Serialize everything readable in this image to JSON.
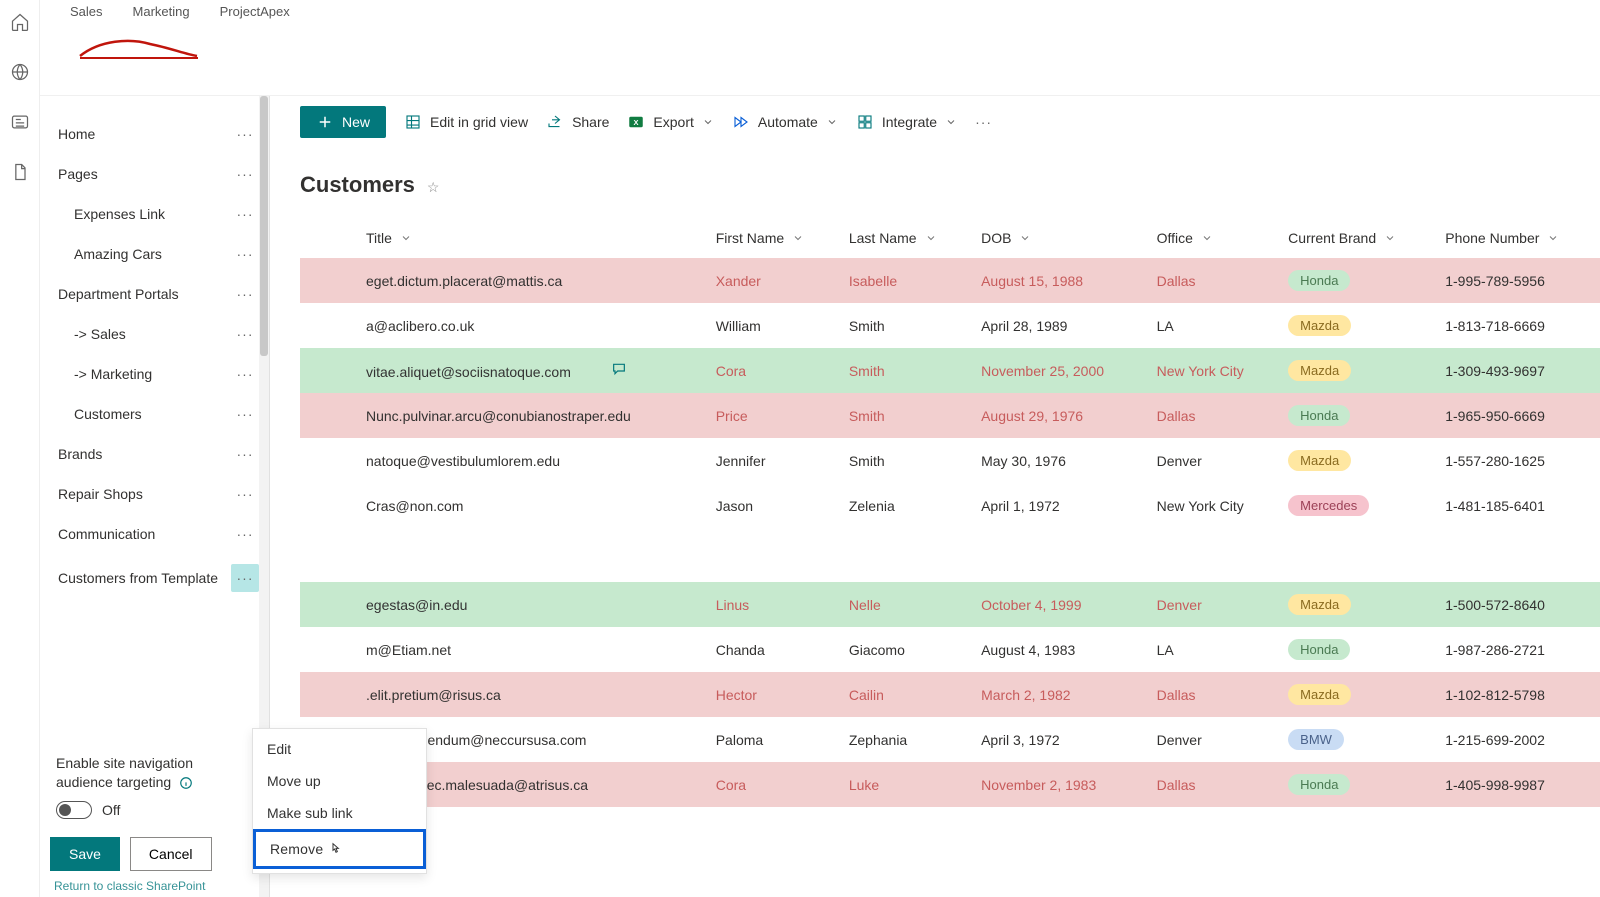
{
  "hub": {
    "sales": "Sales",
    "marketing": "Marketing",
    "project": "ProjectApex"
  },
  "nav": {
    "home": "Home",
    "pages": "Pages",
    "expenses": "Expenses Link",
    "amazing": "Amazing Cars",
    "dept": "Department Portals",
    "sales": "-> Sales",
    "marketing": "-> Marketing",
    "customers": "Customers",
    "brands": "Brands",
    "repair": "Repair Shops",
    "comm": "Communication",
    "ctempl": "Customers from Template"
  },
  "targeting": {
    "title": "Enable site navigation audience targeting",
    "state": "Off"
  },
  "actions": {
    "save": "Save",
    "cancel": "Cancel",
    "returnlink": "Return to classic SharePoint"
  },
  "cmd": {
    "new": "New",
    "editgrid": "Edit in grid view",
    "share": "Share",
    "export": "Export",
    "automate": "Automate",
    "integrate": "Integrate"
  },
  "list": {
    "title": "Customers"
  },
  "columns": {
    "title": "Title",
    "first": "First Name",
    "last": "Last Name",
    "dob": "DOB",
    "office": "Office",
    "brand": "Current Brand",
    "phone": "Phone Number"
  },
  "ctx": {
    "edit": "Edit",
    "moveup": "Move up",
    "sublink": "Make sub link",
    "remove": "Remove"
  },
  "rows": [
    {
      "cls": "row-pink",
      "title": "eget.dictum.placerat@mattis.ca",
      "first": "Xander",
      "last": "Isabelle",
      "dob": "August 15, 1988",
      "office": "Dallas",
      "brand": "Honda",
      "brandcls": "honda",
      "phone": "1-995-789-5956",
      "accent": true
    },
    {
      "cls": "row-white",
      "title": "a@aclibero.co.uk",
      "first": "William",
      "last": "Smith",
      "dob": "April 28, 1989",
      "office": "LA",
      "brand": "Mazda",
      "brandcls": "mazda",
      "phone": "1-813-718-6669"
    },
    {
      "cls": "row-green",
      "title": "vitae.aliquet@sociisnatoque.com",
      "first": "Cora",
      "last": "Smith",
      "dob": "November 25, 2000",
      "office": "New York City",
      "brand": "Mazda",
      "brandcls": "mazda",
      "phone": "1-309-493-9697",
      "accent": true,
      "comment": true
    },
    {
      "cls": "row-pink",
      "title": "Nunc.pulvinar.arcu@conubianostraper.edu",
      "first": "Price",
      "last": "Smith",
      "dob": "August 29, 1976",
      "office": "Dallas",
      "brand": "Honda",
      "brandcls": "honda",
      "phone": "1-965-950-6669",
      "accent": true
    },
    {
      "cls": "row-white",
      "title": "natoque@vestibulumlorem.edu",
      "first": "Jennifer",
      "last": "Smith",
      "dob": "May 30, 1976",
      "office": "Denver",
      "brand": "Mazda",
      "brandcls": "mazda",
      "phone": "1-557-280-1625"
    },
    {
      "cls": "row-white",
      "title": "Cras@non.com",
      "first": "Jason",
      "last": "Zelenia",
      "dob": "April 1, 1972",
      "office": "New York City",
      "brand": "Mercedes",
      "brandcls": "mercedes",
      "phone": "1-481-185-6401"
    }
  ],
  "rows2": [
    {
      "cls": "row-green",
      "title": "egestas@in.edu",
      "first": "Linus",
      "last": "Nelle",
      "dob": "October 4, 1999",
      "office": "Denver",
      "brand": "Mazda",
      "brandcls": "mazda",
      "phone": "1-500-572-8640",
      "accent": true
    },
    {
      "cls": "row-white",
      "title": "m@Etiam.net",
      "first": "Chanda",
      "last": "Giacomo",
      "dob": "August 4, 1983",
      "office": "LA",
      "brand": "Honda",
      "brandcls": "honda",
      "phone": "1-987-286-2721"
    },
    {
      "cls": "row-pink",
      "title": ".elit.pretium@risus.ca",
      "first": "Hector",
      "last": "Cailin",
      "dob": "March 2, 1982",
      "office": "Dallas",
      "brand": "Mazda",
      "brandcls": "mazda",
      "phone": "1-102-812-5798",
      "accent": true
    },
    {
      "cls": "row-white",
      "title": "empor.bibendum@neccursusa.com",
      "first": "Paloma",
      "last": "Zephania",
      "dob": "April 3, 1972",
      "office": "Denver",
      "brand": "BMW",
      "brandcls": "bmw",
      "phone": "1-215-699-2002"
    },
    {
      "cls": "row-pink",
      "title": "eleifend.nec.malesuada@atrisus.ca",
      "first": "Cora",
      "last": "Luke",
      "dob": "November 2, 1983",
      "office": "Dallas",
      "brand": "Honda",
      "brandcls": "honda",
      "phone": "1-405-998-9987",
      "accent": true
    }
  ]
}
